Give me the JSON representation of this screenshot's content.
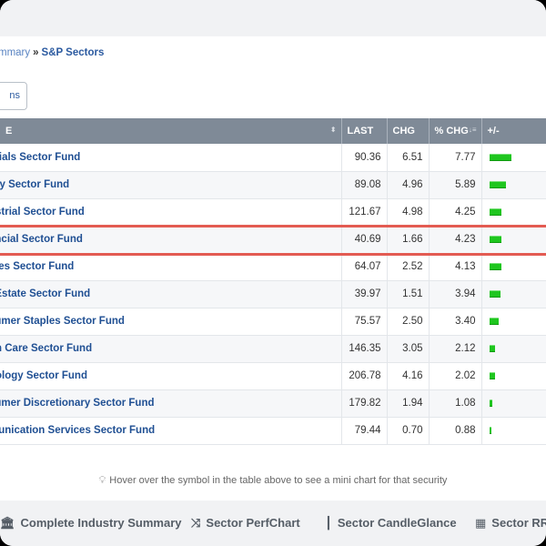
{
  "breadcrumb": {
    "first": "mmary",
    "separator": "»",
    "current": "S&P Sectors"
  },
  "options_button": {
    "label": "ns"
  },
  "table": {
    "columns": [
      "E",
      "LAST",
      "CHG",
      "% CHG",
      "+/-"
    ],
    "rows": [
      {
        "name": "erials Sector Fund",
        "last": "90.36",
        "chg": "6.51",
        "pct": "7.77",
        "bar": 7.77
      },
      {
        "name": "rgy Sector Fund",
        "last": "89.08",
        "chg": "4.96",
        "pct": "5.89",
        "bar": 5.89
      },
      {
        "name": "ustrial Sector Fund",
        "last": "121.67",
        "chg": "4.98",
        "pct": "4.25",
        "bar": 4.25
      },
      {
        "name": "ancial Sector Fund",
        "last": "40.69",
        "chg": "1.66",
        "pct": "4.23",
        "bar": 4.23
      },
      {
        "name": "ities Sector Fund",
        "last": "64.07",
        "chg": "2.52",
        "pct": "4.13",
        "bar": 4.13
      },
      {
        "name": "l Estate Sector Fund",
        "last": "39.97",
        "chg": "1.51",
        "pct": "3.94",
        "bar": 3.94
      },
      {
        "name": "sumer Staples Sector Fund",
        "last": "75.57",
        "chg": "2.50",
        "pct": "3.40",
        "bar": 3.4
      },
      {
        "name": "lth Care Sector Fund",
        "last": "146.35",
        "chg": "3.05",
        "pct": "2.12",
        "bar": 2.12
      },
      {
        "name": "nology Sector Fund",
        "last": "206.78",
        "chg": "4.16",
        "pct": "2.02",
        "bar": 2.02
      },
      {
        "name": "sumer Discretionary Sector Fund",
        "last": "179.82",
        "chg": "1.94",
        "pct": "1.08",
        "bar": 1.08
      },
      {
        "name": "munication Services Sector Fund",
        "last": "79.44",
        "chg": "0.70",
        "pct": "0.88",
        "bar": 0.88
      }
    ],
    "highlighted_row": 3
  },
  "hint": {
    "text": "Hover over the symbol in the table above to see a mini chart for that security"
  },
  "footer": {
    "links": [
      {
        "label": "Complete Industry Summary",
        "icon": "bank-icon"
      },
      {
        "label": "Sector PerfChart",
        "icon": "shuffle-icon"
      },
      {
        "label": "Sector CandleGlance",
        "icon": "candlestick-icon"
      },
      {
        "label": "Sector RRG",
        "icon": "grid-icon"
      }
    ]
  },
  "colors": {
    "accent": "#1f4f93",
    "header_bg": "#7f8a97",
    "bar_green": "#1fc61f",
    "highlight_red": "#e35b52"
  }
}
